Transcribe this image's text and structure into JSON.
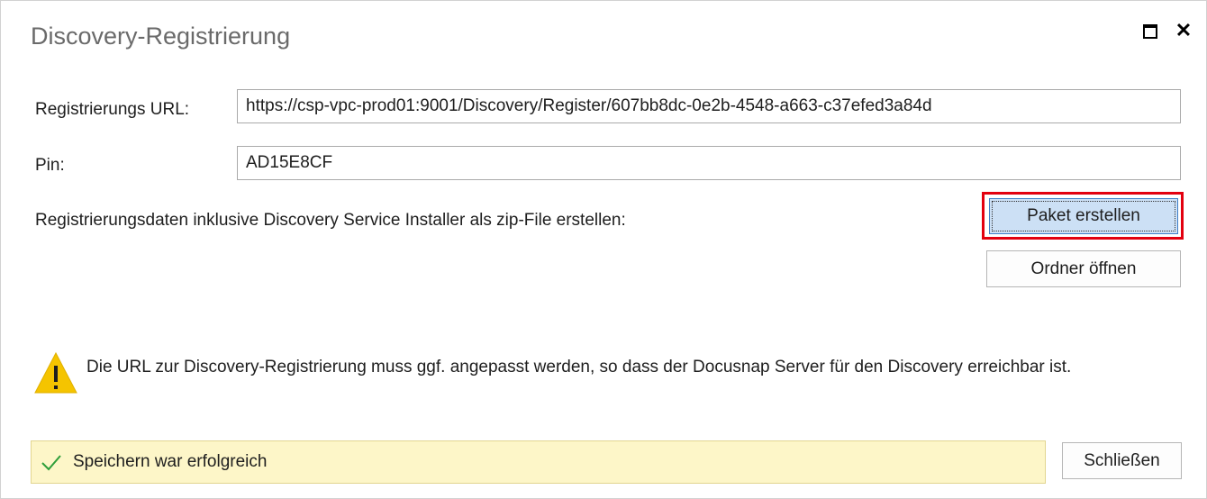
{
  "window": {
    "title": "Discovery-Registrierung",
    "maximize_icon": "maximize-icon",
    "close_icon": "close-icon",
    "close_glyph": "✕"
  },
  "form": {
    "url_label": "Registrierungs URL:",
    "url_value": "https://csp-vpc-prod01:9001/Discovery/Register/607bb8dc-0e2b-4548-a663-c37efed3a84d",
    "pin_label": "Pin:",
    "pin_value": "AD15E8CF",
    "package_label": "Registrierungsdaten inklusive Discovery Service Installer als zip-File erstellen:"
  },
  "buttons": {
    "create_package": "Paket erstellen",
    "open_folder": "Ordner öffnen",
    "close": "Schließen"
  },
  "warning": {
    "icon": "warning-icon",
    "text": "Die URL zur Discovery-Registrierung muss ggf. angepasst werden, so dass der Docusnap Server für den Discovery erreichbar ist."
  },
  "status": {
    "icon": "checkmark-icon",
    "text": "Speichern war erfolgreich"
  },
  "colors": {
    "highlight_border": "#e3000f",
    "status_background": "#fdf6c8",
    "check_green": "#2e9e3a",
    "warning_yellow": "#f5c400"
  }
}
